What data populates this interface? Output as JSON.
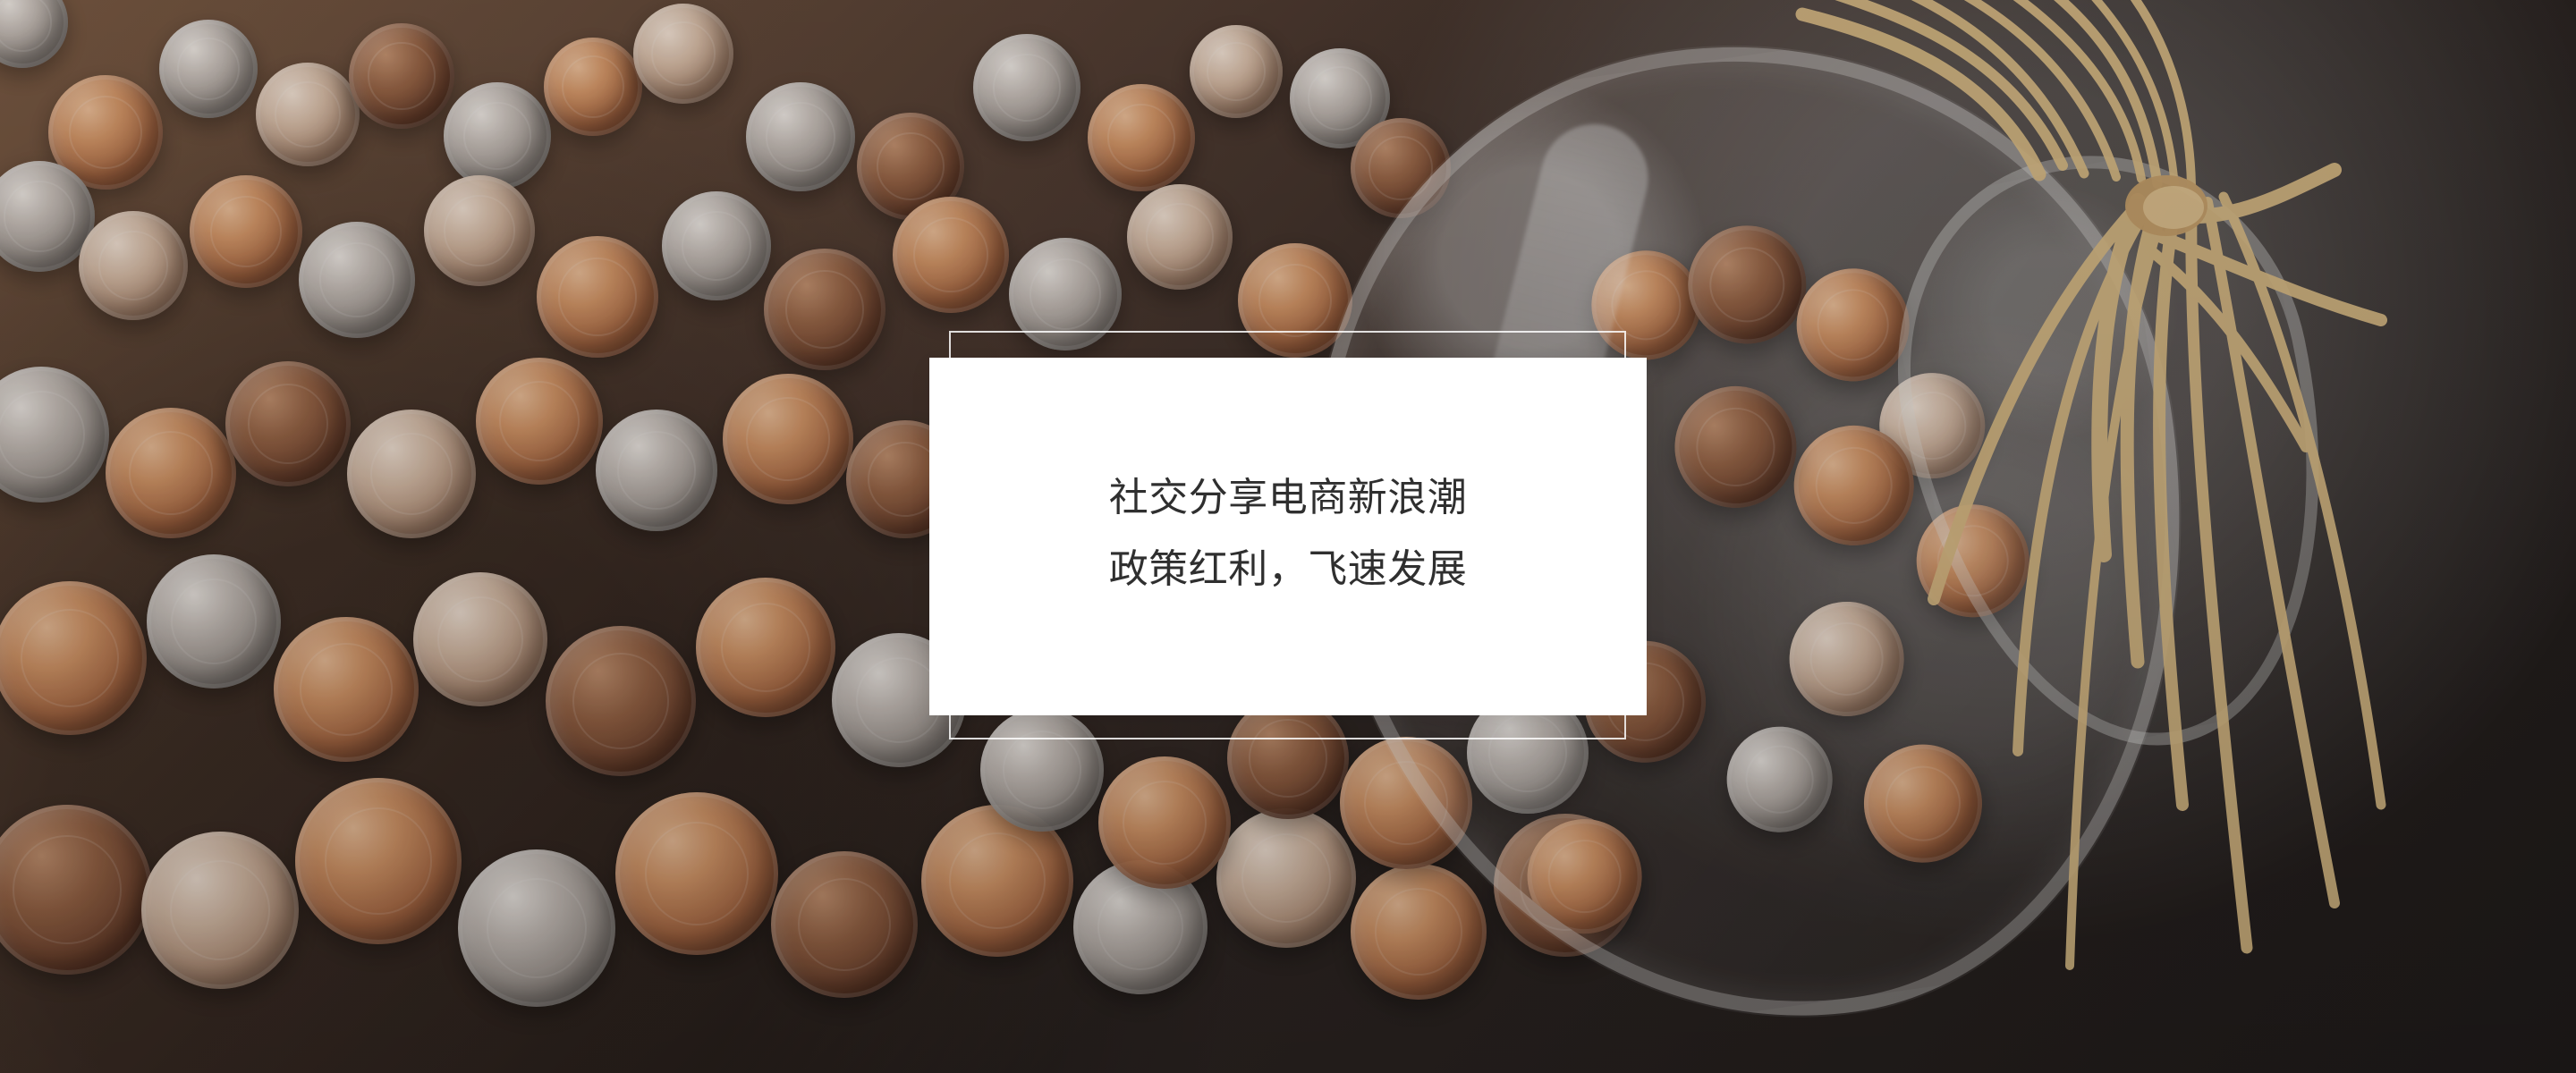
{
  "hero": {
    "headline_line_1": "社交分享电商新浪潮",
    "headline_line_2": "政策红利，飞速发展"
  },
  "colors": {
    "card_background": "#ffffff",
    "text": "#2f2f2f",
    "frame": "#ffffff",
    "copper": "#a96843",
    "silver": "#9e9690",
    "raffia": "#d8b57a",
    "glass": "#d9d9d6"
  }
}
